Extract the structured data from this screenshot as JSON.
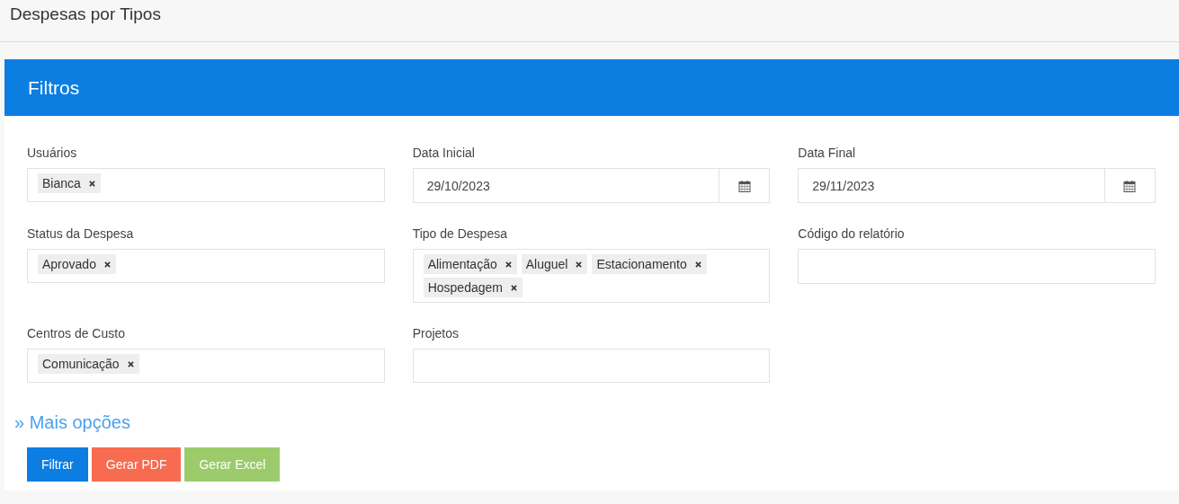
{
  "page": {
    "title": "Despesas por Tipos"
  },
  "panel": {
    "title": "Filtros"
  },
  "fields": [
    {
      "label": "Usuários",
      "kind": "tags",
      "tags": [
        "Bianca"
      ]
    },
    {
      "label": "Data Inicial",
      "kind": "date",
      "value": "29/10/2023"
    },
    {
      "label": "Data Final",
      "kind": "date",
      "value": "29/11/2023"
    },
    {
      "label": "Status da Despesa",
      "kind": "tags",
      "tags": [
        "Aprovado"
      ]
    },
    {
      "label": "Tipo de Despesa",
      "kind": "tags",
      "tags": [
        "Alimentação",
        "Aluguel",
        "Estacionamento",
        "Hospedagem"
      ]
    },
    {
      "label": "Código do relatório",
      "kind": "text"
    },
    {
      "label": "Centros de Custo",
      "kind": "tags",
      "tags": [
        "Comunicação"
      ]
    },
    {
      "label": "Projetos",
      "kind": "tags"
    }
  ],
  "more_options": "» Mais opções",
  "buttons": [
    {
      "label": "Filtrar",
      "kind": "primary"
    },
    {
      "label": "Gerar PDF",
      "kind": "danger"
    },
    {
      "label": "Gerar Excel",
      "kind": "success"
    }
  ]
}
